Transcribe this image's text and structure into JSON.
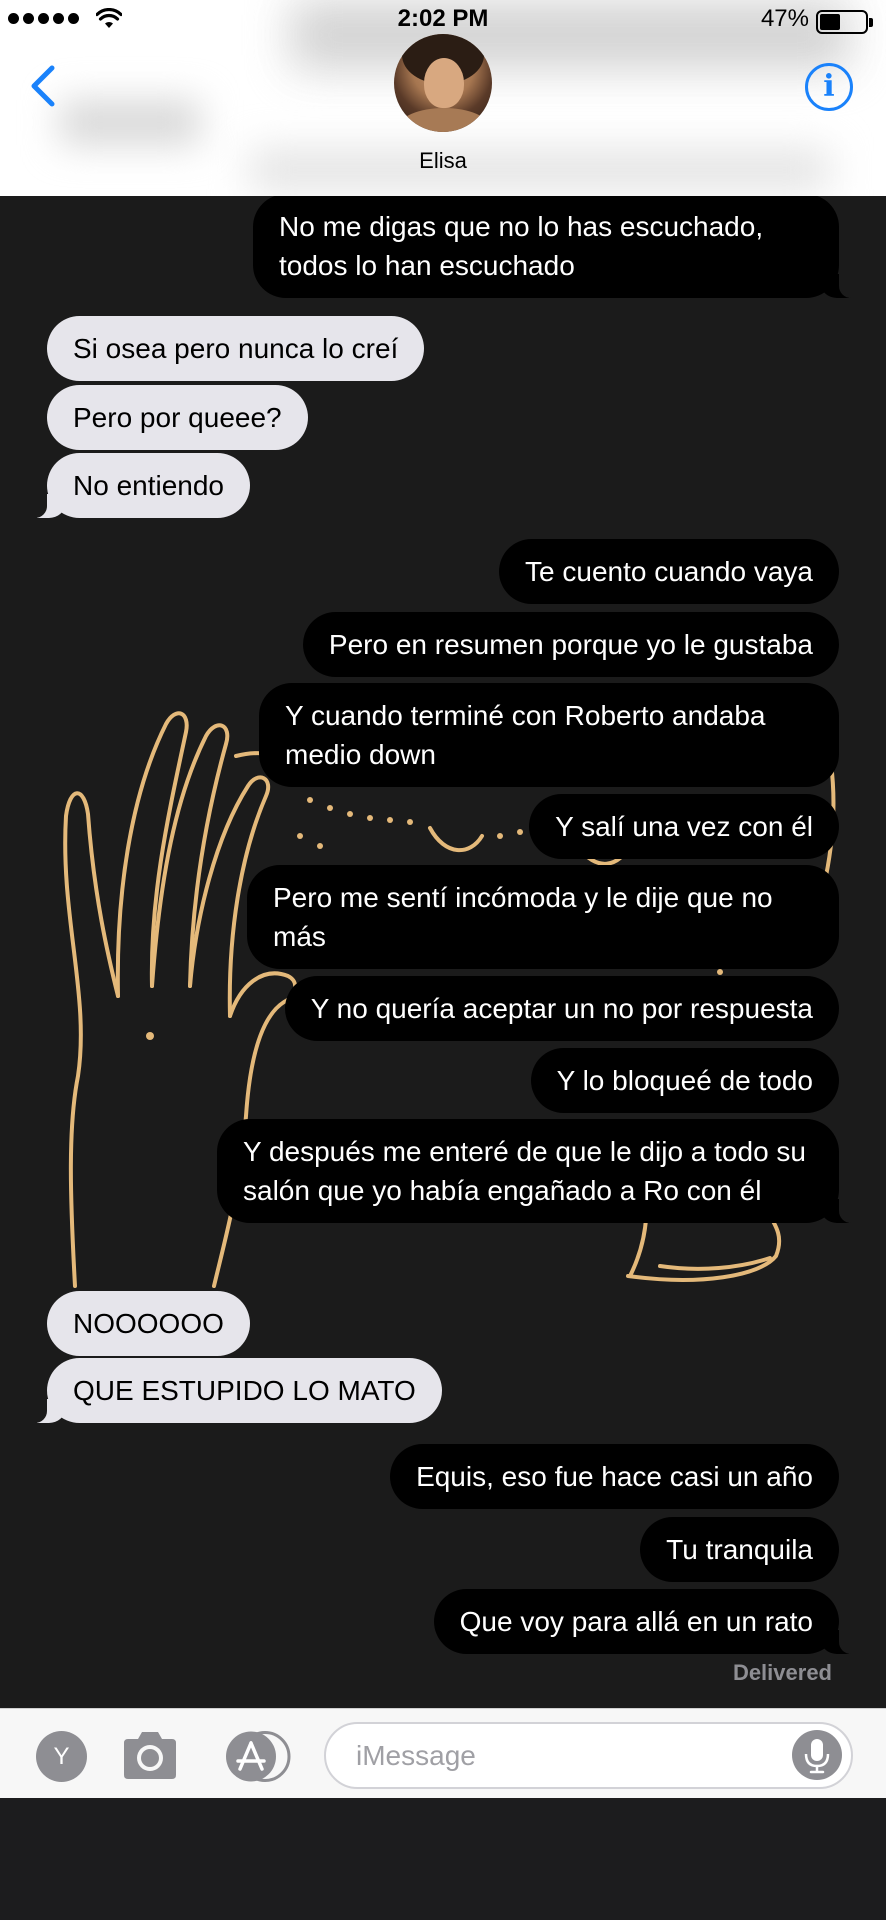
{
  "status_bar": {
    "time": "2:02 PM",
    "battery": "47%"
  },
  "header": {
    "contact_name": "Elisa"
  },
  "messages": [
    {
      "dir": "out",
      "text": "No me digas que no lo has escuchado, todos lo han escuchado"
    },
    {
      "dir": "in",
      "text": "Si osea pero nunca lo creí"
    },
    {
      "dir": "in",
      "text": "Pero por queee?"
    },
    {
      "dir": "in",
      "text": "No entiendo"
    },
    {
      "dir": "out",
      "text": "Te cuento cuando vaya"
    },
    {
      "dir": "out",
      "text": "Pero en resumen porque yo le gustaba"
    },
    {
      "dir": "out",
      "text": "Y cuando terminé con Roberto andaba medio down"
    },
    {
      "dir": "out",
      "text": "Y salí una vez con él"
    },
    {
      "dir": "out",
      "text": "Pero me sentí incómoda y le dije que no más"
    },
    {
      "dir": "out",
      "text": "Y no quería aceptar un no por respuesta"
    },
    {
      "dir": "out",
      "text": "Y lo bloqueé de todo"
    },
    {
      "dir": "out",
      "text": "Y después me enteré de que le dijo a todo su salón que yo había engañado a Ro con él"
    },
    {
      "dir": "in",
      "text": "NOOOOOO"
    },
    {
      "dir": "in",
      "text": "QUE ESTUPIDO LO MATO"
    },
    {
      "dir": "out",
      "text": "Equis, eso fue hace casi un año"
    },
    {
      "dir": "out",
      "text": "Tu tranquila"
    },
    {
      "dir": "out",
      "text": "Que voy para allá en un rato"
    }
  ],
  "delivered_label": "Delivered",
  "input": {
    "placeholder": "iMessage",
    "apps_label": "Y"
  },
  "colors": {
    "accent": "#1a82fb",
    "incoming": "#e6e5eb",
    "outgoing": "#000000",
    "background": "#1b1b1b"
  },
  "icons": [
    "back-chevron-icon",
    "info-icon",
    "camera-icon",
    "app-store-icon",
    "microphone-icon",
    "wifi-icon"
  ]
}
